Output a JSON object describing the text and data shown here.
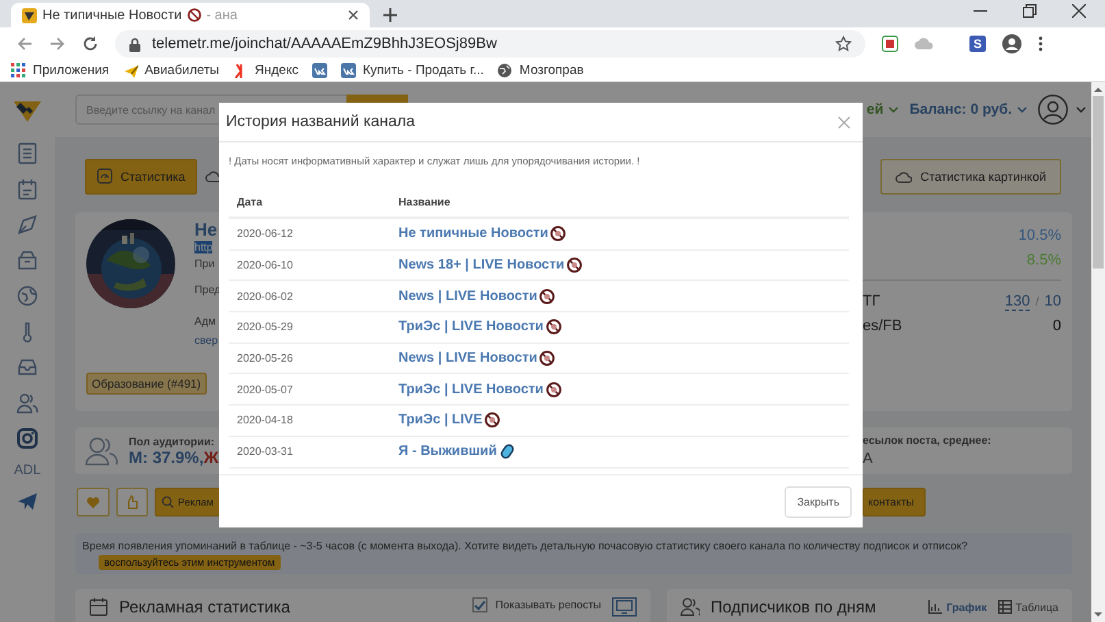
{
  "browser": {
    "tab": {
      "title": "Не типичные Новости",
      "title_tail": "- ана"
    },
    "url": "telemetr.me/joinchat/AAAAAEmZ9BhhJ3EOSj89Bw",
    "extension_letter": "S",
    "bookmarks": [
      {
        "label": "Приложения",
        "kind": "apps"
      },
      {
        "label": "Авиабилеты",
        "kind": "plane"
      },
      {
        "label": "Яндекс",
        "kind": "yandex"
      },
      {
        "kind": "vk"
      },
      {
        "label": "Купить - Продать г...",
        "kind": "vk"
      },
      {
        "label": "Мозгоправ",
        "kind": "globe"
      }
    ]
  },
  "sidebar": {
    "label": "ADL"
  },
  "header": {
    "search_placeholder": "Введите ссылку на канал",
    "menu_fragment": "ей",
    "balance": "Баланс: 0 руб."
  },
  "toolbar": {
    "stats_button": "Статистика",
    "image_stats_button": "Статистика картинкой"
  },
  "channel": {
    "name": "Не",
    "link": "http",
    "lines": [
      "При",
      "Пред",
      "Адм"
    ],
    "admin_link": "свер",
    "category": "Образование (#491)",
    "metrics": [
      {
        "value": "10.5%",
        "color": "#35577f"
      },
      {
        "value": "8.5%",
        "color": "#4a7a33"
      }
    ],
    "stats": [
      {
        "label": "ТГ",
        "value": "130",
        "separator": "/",
        "total": "10"
      },
      {
        "label": "es/FB",
        "value": "0"
      }
    ]
  },
  "audience": {
    "label": "Пол аудитории:",
    "male": "М: 37.9%,",
    "female": "Ж"
  },
  "reposts": {
    "label": "есылок поста, среднее:",
    "value": "А"
  },
  "actions": {
    "ads_button": "Реклам",
    "contacts_button": "контакты"
  },
  "notice": {
    "text": "Время появления упоминаний в таблице - ~3-5 часов (с момента выхода). Хотите видеть детальную почасовую статистику своего канала по количеству подписок и отписок?",
    "link": "воспользуйтесь этим инструментом"
  },
  "ads_panel": {
    "title": "Рекламная статистика",
    "show_reposts": {
      "label": "Показывать репосты",
      "checked": true
    }
  },
  "subscribers_panel": {
    "title": "Подписчиков по дням",
    "views": [
      {
        "label": "График",
        "selected": true
      },
      {
        "label": "Таблица",
        "selected": false
      }
    ]
  },
  "modal": {
    "title": "История названий канала",
    "note": "! Даты носят информативный характер и служат лишь для упорядочивания истории. !",
    "columns": [
      "Дата",
      "Название"
    ],
    "rows": [
      {
        "date": "2020-06-12",
        "name": "Не типичные Новости",
        "kind": "adult"
      },
      {
        "date": "2020-06-10",
        "name": "News 18+ | LIVE Новости",
        "kind": "adult"
      },
      {
        "date": "2020-06-02",
        "name": "News | LIVE Новости",
        "kind": "adult"
      },
      {
        "date": "2020-05-29",
        "name": "ТриЭс | LIVE Новости",
        "kind": "adult"
      },
      {
        "date": "2020-05-26",
        "name": "News | LIVE Новости",
        "kind": "adult"
      },
      {
        "date": "2020-05-07",
        "name": "ТриЭс | LIVE Новости",
        "kind": "adult"
      },
      {
        "date": "2020-04-18",
        "name": "ТриЭс | LIVE",
        "kind": "adult"
      },
      {
        "date": "2020-03-31",
        "name": "Я - Выживший",
        "kind": "capsule"
      }
    ],
    "close_button": "Закрыть"
  }
}
